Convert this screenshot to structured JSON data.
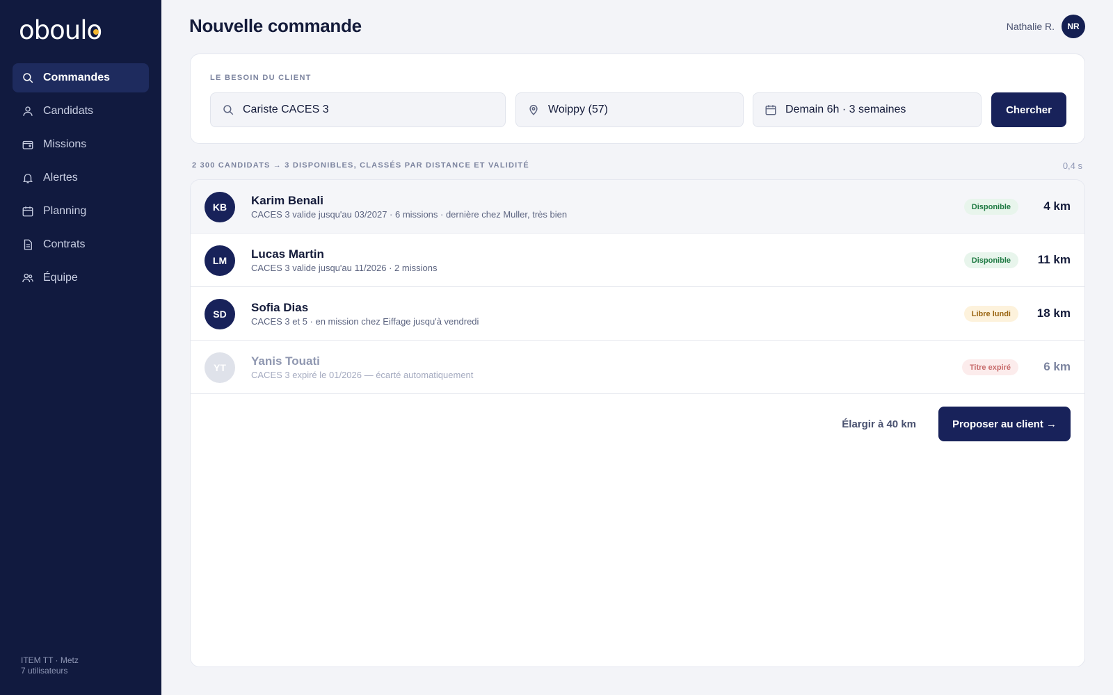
{
  "brand": {
    "logo": "oboulo",
    "accent": "#f2b632"
  },
  "sidebar": {
    "items": [
      {
        "label": "Commandes",
        "icon": "search-icon",
        "active": true
      },
      {
        "label": "Candidats",
        "icon": "person-icon"
      },
      {
        "label": "Missions",
        "icon": "wallet-icon"
      },
      {
        "label": "Alertes",
        "icon": "bell-icon"
      },
      {
        "label": "Planning",
        "icon": "calendar-icon"
      },
      {
        "label": "Contrats",
        "icon": "document-icon"
      },
      {
        "label": "Équipe",
        "icon": "team-icon"
      }
    ],
    "footer": {
      "agency": "ITEM TT · Metz",
      "users": "7 utilisateurs"
    }
  },
  "header": {
    "title": "Nouvelle commande",
    "user_name": "Nathalie R.",
    "user_initials": "NR"
  },
  "search": {
    "label": "LE BESOIN DU CLIENT",
    "job": "Cariste CACES 3",
    "location": "Woippy (57)",
    "schedule": "Demain 6h · 3 semaines",
    "button": "Chercher"
  },
  "results": {
    "summary": "2 300 CANDIDATS → 3 DISPONIBLES, CLASSÉS PAR DISTANCE ET VALIDITÉ",
    "time": "0,4 s",
    "candidates": [
      {
        "initials": "KB",
        "name": "Karim Benali",
        "detail": "CACES 3 valide jusqu'au 03/2027 · 6 missions · dernière chez Muller, très bien",
        "status": "Disponible",
        "distance": "4 km"
      },
      {
        "initials": "LM",
        "name": "Lucas Martin",
        "detail": "CACES 3 valide jusqu'au 11/2026 · 2 missions",
        "status": "Disponible",
        "distance": "11 km"
      },
      {
        "initials": "SD",
        "name": "Sofia Dias",
        "detail": "CACES 3 et 5 · en mission chez Eiffage jusqu'à vendredi",
        "status": "Libre lundi",
        "distance": "18 km"
      },
      {
        "initials": "YT",
        "name": "Yanis Touati",
        "detail": "CACES 3 expiré le 01/2026 — écarté automatiquement",
        "status": "Titre expiré",
        "distance": "6 km"
      }
    ],
    "widen_label": "Élargir à 40 km",
    "propose_label": "Proposer au client →"
  }
}
